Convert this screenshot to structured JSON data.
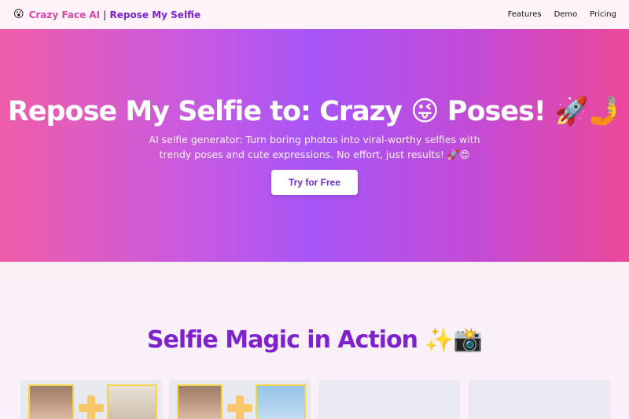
{
  "nav": {
    "emoji": "😮",
    "brand_primary": "Crazy Face AI",
    "brand_separator": "|",
    "brand_secondary": "Repose My Selfie",
    "links": [
      "Features",
      "Demo",
      "Pricing"
    ]
  },
  "hero": {
    "title": "Repose My Selfie to: Crazy 😜 Poses! 🚀🤳",
    "subtitle": "AI selfie generator: Turn boring photos into viral-worthy selfies with trendy poses and cute expressions. No effort, just results! 🚀😍",
    "cta": "Try for Free"
  },
  "demo_section": {
    "title": "Selfie Magic in Action ✨📸"
  },
  "colors": {
    "brand_pink": "#d946a8",
    "brand_purple": "#7e22ce",
    "hero_gradient_start": "#ef5da8",
    "hero_gradient_mid": "#a855f7",
    "hero_gradient_end": "#ec4899"
  }
}
